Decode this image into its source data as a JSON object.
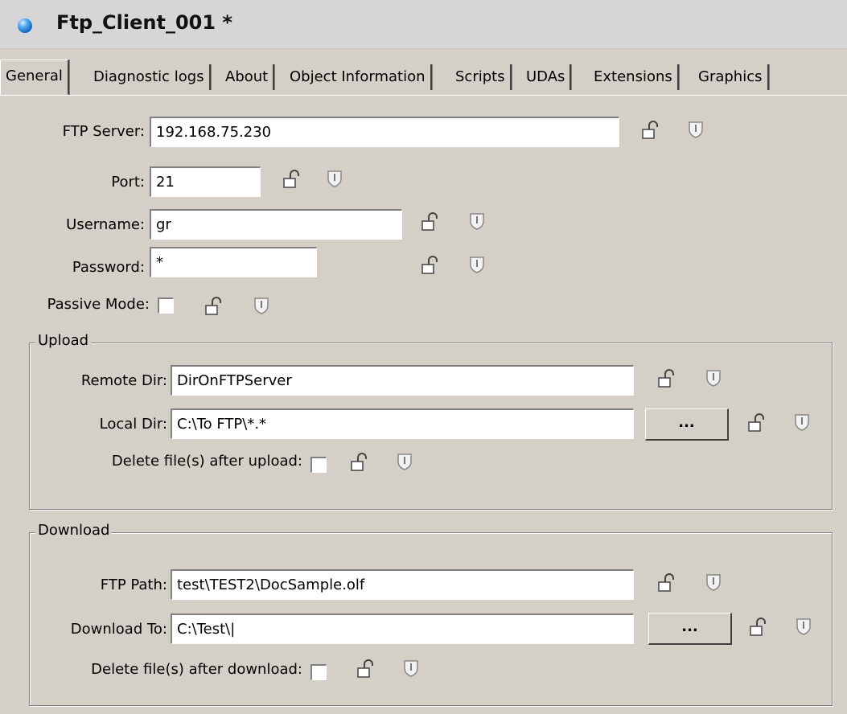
{
  "window": {
    "title": "Ftp_Client_001 *"
  },
  "tabs": [
    {
      "label": "General"
    },
    {
      "label": "Diagnostic logs"
    },
    {
      "label": "About"
    },
    {
      "label": "Object Information"
    },
    {
      "label": "Scripts"
    },
    {
      "label": "UDAs"
    },
    {
      "label": "Extensions"
    },
    {
      "label": "Graphics"
    }
  ],
  "general": {
    "ftp_server": {
      "label": "FTP Server:",
      "value": "192.168.75.230"
    },
    "port": {
      "label": "Port:",
      "value": "21"
    },
    "username": {
      "label": "Username:",
      "value": "gr"
    },
    "password": {
      "label": "Password:",
      "value": "*"
    },
    "passive_mode": {
      "label": "Passive Mode:",
      "checked": false
    }
  },
  "upload": {
    "title": "Upload",
    "remote_dir": {
      "label": "Remote Dir:",
      "value": "DirOnFTPServer"
    },
    "local_dir": {
      "label": "Local Dir:",
      "value": "C:\\To FTP\\*.*",
      "browse_label": "..."
    },
    "delete_after": {
      "label": "Delete file(s) after upload:",
      "checked": false
    }
  },
  "download": {
    "title": "Download",
    "ftp_path": {
      "label": "FTP Path:",
      "value": "test\\TEST2\\DocSample.olf"
    },
    "download_to": {
      "label": "Download To:",
      "value": "C:\\Test\\|",
      "browse_label": "..."
    },
    "delete_after": {
      "label": "Delete file(s) after download:",
      "checked": false
    }
  },
  "icons": {
    "lock": "unlocked-padlock-icon",
    "shield": "shield-icon"
  }
}
